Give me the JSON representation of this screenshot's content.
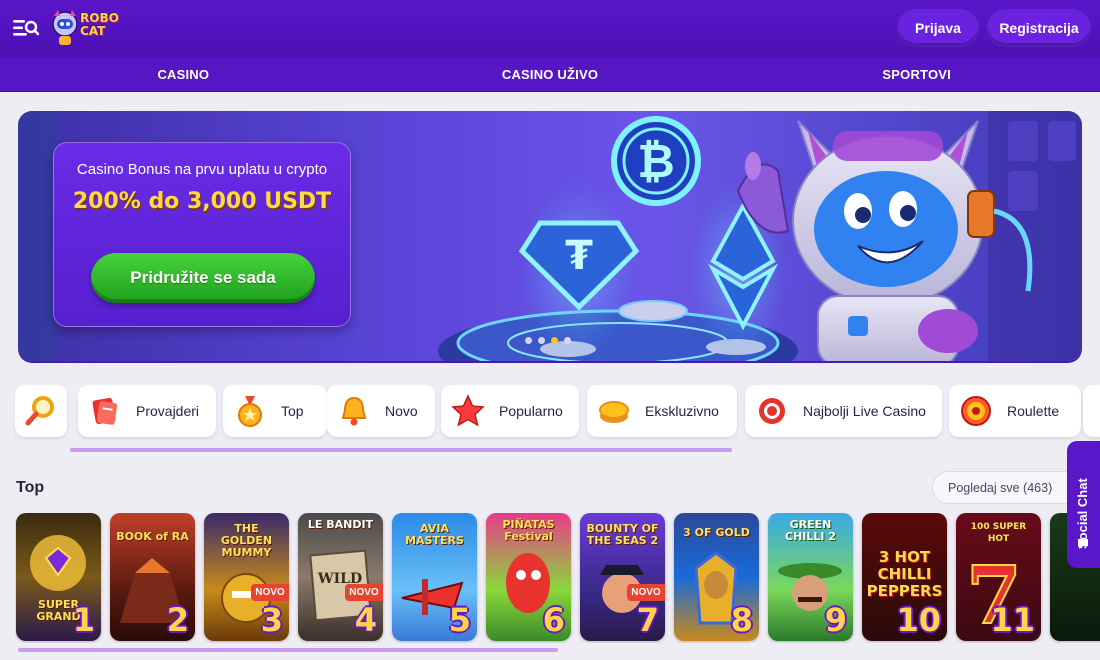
{
  "header": {
    "logo_text": "ROBO CAT",
    "login_label": "Prijava",
    "register_label": "Registracija"
  },
  "nav": {
    "items": [
      "CASINO",
      "CASINO UŽIVO",
      "SPORTOVI"
    ]
  },
  "banner": {
    "headline": "Casino Bonus na prvu uplatu u crypto",
    "amount": "200% do 3,000 USDT",
    "cta_label": "Pridružite se sada",
    "slides": 4,
    "active_slide": 3
  },
  "categories": [
    {
      "label": "",
      "icon": "search-icon"
    },
    {
      "label": "Provajderi",
      "icon": "providers-icon"
    },
    {
      "label": "Top",
      "icon": "medal-icon"
    },
    {
      "label": "Novo",
      "icon": "bell-icon"
    },
    {
      "label": "Popularno",
      "icon": "star-icon"
    },
    {
      "label": "Ekskluzivno",
      "icon": "coins-icon"
    },
    {
      "label": "Najbolji Live Casino",
      "icon": "roulette-chip-icon"
    },
    {
      "label": "Roulette",
      "icon": "roulette-wheel-icon"
    }
  ],
  "top_section": {
    "title": "Top",
    "view_all_label": "Pogledaj sve (463)",
    "games": [
      {
        "title": "SUPER GRAND",
        "rank": "1",
        "badge": ""
      },
      {
        "title": "BOOK of RA",
        "rank": "2",
        "badge": ""
      },
      {
        "title": "THE GOLDEN MUMMY",
        "rank": "3",
        "badge": "NOVO"
      },
      {
        "title": "LE BANDIT",
        "rank": "4",
        "badge": "NOVO"
      },
      {
        "title": "AVIA MASTERS",
        "rank": "5",
        "badge": ""
      },
      {
        "title": "PIÑATAS Festival",
        "rank": "6",
        "badge": ""
      },
      {
        "title": "BOUNTY OF THE SEAS 2",
        "rank": "7",
        "badge": "NOVO"
      },
      {
        "title": "3 OF GOLD",
        "rank": "8",
        "badge": ""
      },
      {
        "title": "GREEN CHILLI 2",
        "rank": "9",
        "badge": ""
      },
      {
        "title": "3 HOT CHILLI PEPPERS",
        "rank": "10",
        "badge": ""
      },
      {
        "title": "100 SUPER HOT",
        "rank": "11",
        "badge": ""
      },
      {
        "title": "",
        "rank": "",
        "badge": ""
      }
    ]
  },
  "social_chat_label": "Social Chat",
  "colors": {
    "brand_purple": "#5a16c9",
    "accent_yellow": "#ffd84a",
    "cta_green": "#2fb52a",
    "new_badge_red": "#e8432e"
  }
}
